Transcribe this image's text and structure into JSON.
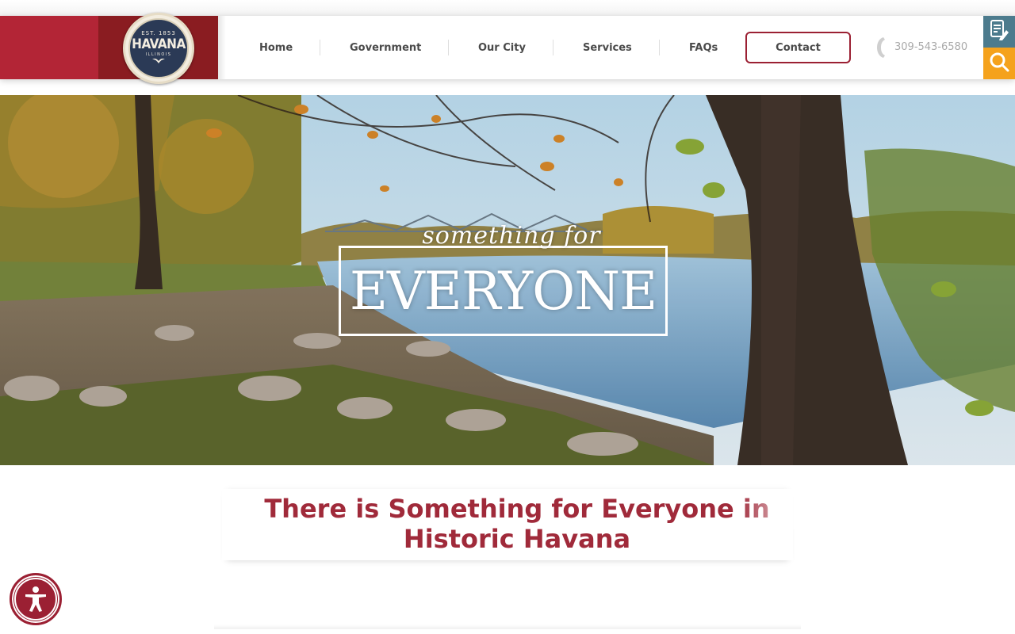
{
  "header": {
    "logo": {
      "est": "EST. 1853",
      "name": "HAVANA",
      "state": "ILLINOIS"
    },
    "nav": [
      {
        "label": "Home"
      },
      {
        "label": "Government"
      },
      {
        "label": "Our City"
      },
      {
        "label": "Services"
      },
      {
        "label": "FAQs"
      }
    ],
    "contact_label": "Contact",
    "phone": "309-543-6580",
    "side_buttons": [
      "document-edit-icon",
      "search-icon"
    ]
  },
  "hero": {
    "script_text": "something for",
    "title": "EVERYONE"
  },
  "intro": {
    "title": "There is Something for Everyone in Historic Havana"
  },
  "colors": {
    "brand_red": "#b32536",
    "brand_dark_red": "#8a1c21",
    "accent_crimson": "#9b2033",
    "teal": "#4c7b8d",
    "orange": "#f5a21c",
    "heading": "#a02a3a"
  },
  "accessibility": {
    "icon": "accessibility-icon"
  }
}
